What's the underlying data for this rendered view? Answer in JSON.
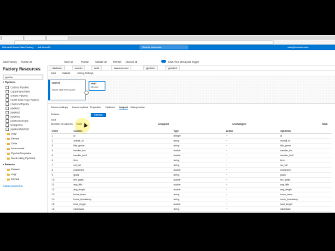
{
  "browser": {
    "tabs": [
      "",
      "",
      ""
    ],
    "url": ""
  },
  "azure": {
    "brand": "Microsoft Azure",
    "factory": "Data Factory",
    "factory_name": "adf-demo01",
    "search_placeholder": "Search resources",
    "user": "user@contoso.com"
  },
  "toolbar": {
    "items": [
      "Data Factory",
      "Publish all",
      "Save all",
      "Publish",
      "Validate all",
      "Refresh",
      "Discard all",
      "Data Flow debug",
      "Add trigger"
    ]
  },
  "sidebar": {
    "title": "Factory Resources",
    "filter": "pipeline",
    "sections": {
      "pipelines": "Pipelines",
      "datasets": "Datasets"
    },
    "pipeline_items": [
      "Cosmos Pipeline",
      "CopySharedTable",
      "Gridbot Pipeline",
      "Health Data Copy Pipeline",
      "cdwExcelPipeline",
      "pipeline1",
      "pipeline2",
      "pipeline3",
      "pipelineExample",
      "testpipeline",
      "pipelineMetaTest",
      "copy",
      "Demos",
      "Grids",
      "Incremental",
      "PipelineTemplates",
      "Movie rating Pipelines"
    ],
    "dataset_items": [
      "Dataset",
      "copy",
      "Demos"
    ],
    "footer": "Global parameters"
  },
  "editor": {
    "tabs": [
      "dataflow1",
      "source1",
      "sink1",
      "datasetpreview",
      "pipeline1",
      "pipeline2"
    ],
    "tools": [
      "Save",
      "Validate",
      "Debug Settings"
    ],
    "nodes": {
      "source_title": "source1",
      "source_desc": "Import data from source",
      "sink_title": "sink1",
      "sink_meta": "88 total"
    }
  },
  "panel": {
    "tabs": [
      "Source settings",
      "Source options",
      "Projection",
      "Optimize",
      "Inspect",
      "Data preview"
    ],
    "active_tab": "Inspect",
    "subbar": "Schema",
    "refresh_button": "Refresh",
    "subrow": "Input",
    "summary": {
      "label": "Number of columns",
      "value": "Total",
      "dropped": "Dropped",
      "unchanged": "Unchanged",
      "total_label": "Total"
    },
    "columns": [
      "Order",
      "Column",
      "Type",
      "Action",
      "Upstream"
    ],
    "rows": [
      [
        "1",
        "id",
        "integer",
        "~",
        "id"
      ],
      [
        "2",
        "overall_id",
        "string",
        "~",
        "overall_id"
      ],
      [
        "3",
        "title_genre",
        "string",
        "~",
        "title_genre"
      ],
      [
        "4",
        "handler_bin",
        "double",
        "~",
        "handler_bin"
      ],
      [
        "5",
        "handler_bin2",
        "double",
        "~",
        "handler_bin2"
      ],
      [
        "6",
        "item",
        "string",
        "~",
        "item"
      ],
      [
        "7",
        "col_val",
        "string",
        "~",
        "col_val"
      ],
      [
        "8",
        "mainIndex",
        "double",
        "~",
        "mainIndex"
      ],
      [
        "9",
        "goals",
        "string",
        "~",
        "goals"
      ],
      [
        "10",
        "iter_goals",
        "double",
        "~",
        "iter_goals"
      ],
      [
        "11",
        "ang_fifth",
        "double",
        "~",
        "ang_fifth"
      ],
      [
        "12",
        "ang_length",
        "double",
        "~",
        "ang_length"
      ],
      [
        "13",
        "home_team",
        "string",
        "~",
        "home_team"
      ],
      [
        "14",
        "home_timestamp",
        "string",
        "~",
        "home_timestamp"
      ],
      [
        "15",
        "heat_length",
        "double",
        "~",
        "heat_length"
      ],
      [
        "16",
        "raisedsaw",
        "string",
        "~",
        "raisedsaw"
      ]
    ]
  },
  "colors": {
    "accent": "#0078d4",
    "highlight": "#ffeb3b",
    "folder": "#e8b94a"
  }
}
